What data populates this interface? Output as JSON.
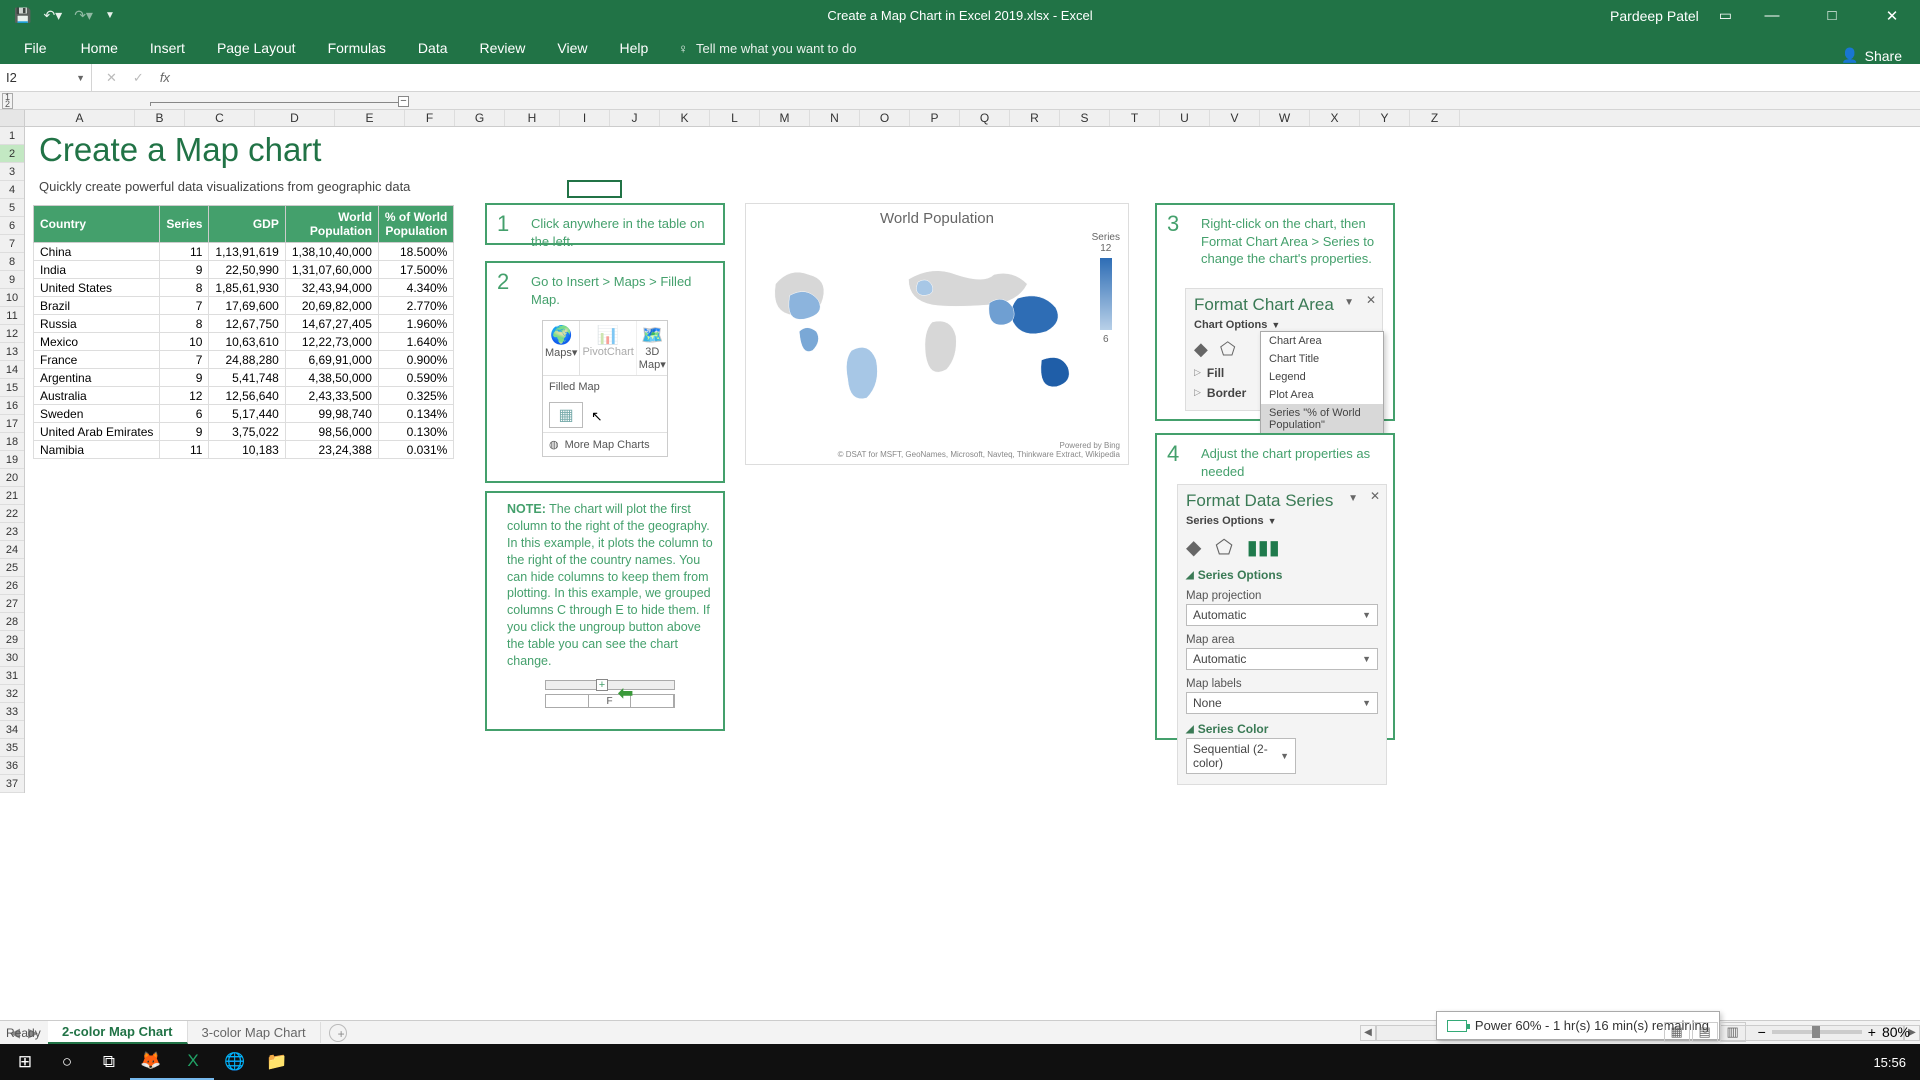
{
  "titlebar": {
    "filename": "Create a Map Chart in Excel 2019.xlsx  -  Excel",
    "user": "Pardeep Patel"
  },
  "ribbon": {
    "file": "File",
    "tabs": [
      "Home",
      "Insert",
      "Page Layout",
      "Formulas",
      "Data",
      "Review",
      "View",
      "Help"
    ],
    "tell_me": "Tell me what you want to do",
    "share": "Share"
  },
  "formula_bar": {
    "name_box": "I2",
    "formula": ""
  },
  "column_letters": [
    "A",
    "B",
    "C",
    "D",
    "E",
    "F",
    "G",
    "H",
    "I",
    "J",
    "K",
    "L",
    "M",
    "N",
    "O",
    "P",
    "Q",
    "R",
    "S",
    "T",
    "U",
    "V",
    "W",
    "X",
    "Y",
    "Z"
  ],
  "sheet": {
    "title": "Create a Map chart",
    "subtitle": "Quickly create powerful data visualizations from geographic data",
    "table": {
      "headers": [
        "Country",
        "Series",
        "GDP",
        "World Population",
        "% of World Population"
      ],
      "rows": [
        [
          "China",
          "11",
          "1,13,91,619",
          "1,38,10,40,000",
          "18.500%"
        ],
        [
          "India",
          "9",
          "22,50,990",
          "1,31,07,60,000",
          "17.500%"
        ],
        [
          "United States",
          "8",
          "1,85,61,930",
          "32,43,94,000",
          "4.340%"
        ],
        [
          "Brazil",
          "7",
          "17,69,600",
          "20,69,82,000",
          "2.770%"
        ],
        [
          "Russia",
          "8",
          "12,67,750",
          "14,67,27,405",
          "1.960%"
        ],
        [
          "Mexico",
          "10",
          "10,63,610",
          "12,22,73,000",
          "1.640%"
        ],
        [
          "France",
          "7",
          "24,88,280",
          "6,69,91,000",
          "0.900%"
        ],
        [
          "Argentina",
          "9",
          "5,41,748",
          "4,38,50,000",
          "0.590%"
        ],
        [
          "Australia",
          "12",
          "12,56,640",
          "2,43,33,500",
          "0.325%"
        ],
        [
          "Sweden",
          "6",
          "5,17,440",
          "99,98,740",
          "0.134%"
        ],
        [
          "United Arab Emirates",
          "9",
          "3,75,022",
          "98,56,000",
          "0.130%"
        ],
        [
          "Namibia",
          "11",
          "10,183",
          "23,24,388",
          "0.031%"
        ]
      ]
    },
    "steps": {
      "s1": {
        "num": "1",
        "text": "Click anywhere in the table on the left."
      },
      "s2": {
        "num": "2",
        "text": "Go to Insert > Maps > Filled Map.",
        "ribbon_items": [
          "Maps",
          "PivotChart",
          "3D Map"
        ],
        "filled_label": "Filled Map",
        "more_label": "More Map Charts"
      },
      "note": {
        "label": "NOTE:",
        "text": "The chart will plot the first column to the right of the geography. In this example, it plots the column to the right of the country names. You can hide columns to keep them from plotting. In this example, we grouped columns C through E to hide them. If you click the ungroup button above the table you can see the chart change.",
        "col_letter": "F"
      },
      "s3": {
        "num": "3",
        "text": "Right-click on the chart, then Format Chart Area > Series to change the chart's properties."
      },
      "s4": {
        "num": "4",
        "text": "Adjust the chart properties as needed"
      }
    },
    "map": {
      "title": "World Population",
      "legend_label": "Series",
      "legend_max": "12",
      "legend_min": "6",
      "powered": "Powered by Bing",
      "credit": "© DSAT for MSFT, GeoNames, Microsoft, Navteq, Thinkware Extract, Wikipedia"
    },
    "format_chart_area": {
      "title": "Format Chart Area",
      "sub": "Chart Options",
      "fill": "Fill",
      "border": "Border",
      "menu": [
        "Chart Area",
        "Chart Title",
        "Legend",
        "Plot Area",
        "Series \"% of World Population\""
      ]
    },
    "format_data_series": {
      "title": "Format Data Series",
      "sub": "Series Options",
      "section1": "Series Options",
      "map_projection": "Map projection",
      "map_projection_v": "Automatic",
      "map_area": "Map area",
      "map_area_v": "Automatic",
      "map_labels": "Map labels",
      "map_labels_v": "None",
      "section2": "Series Color",
      "series_color_v": "Sequential (2-color)"
    }
  },
  "sheet_tabs": {
    "tab1": "2-color Map Chart",
    "tab2": "3-color Map Chart"
  },
  "statusbar": {
    "ready": "Ready",
    "zoom": "80%"
  },
  "battery": "Power 60% - 1 hr(s) 16 min(s) remaining",
  "taskbar": {
    "clock": "15:56"
  },
  "chart_data": {
    "type": "map",
    "title": "World Population",
    "legend_label": "Series",
    "color_scale": {
      "min": 6,
      "max": 12,
      "low_color": "#b8d0e8",
      "high_color": "#2e6db5"
    },
    "data": [
      {
        "country": "China",
        "series": 11
      },
      {
        "country": "India",
        "series": 9
      },
      {
        "country": "United States",
        "series": 8
      },
      {
        "country": "Brazil",
        "series": 7
      },
      {
        "country": "Russia",
        "series": 8
      },
      {
        "country": "Mexico",
        "series": 10
      },
      {
        "country": "France",
        "series": 7
      },
      {
        "country": "Argentina",
        "series": 9
      },
      {
        "country": "Australia",
        "series": 12
      },
      {
        "country": "Sweden",
        "series": 6
      },
      {
        "country": "United Arab Emirates",
        "series": 9
      },
      {
        "country": "Namibia",
        "series": 11
      }
    ]
  }
}
